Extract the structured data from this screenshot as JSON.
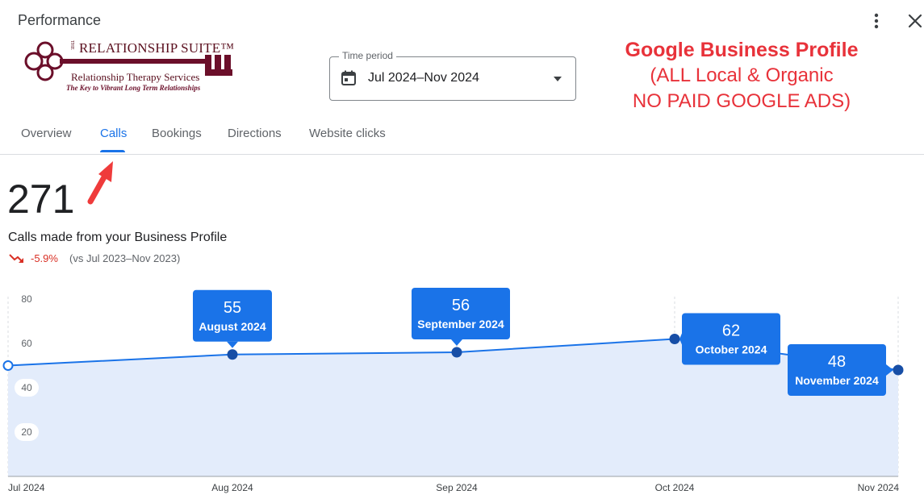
{
  "header": {
    "title": "Performance",
    "more_icon": "more-vert-icon",
    "close_icon": "close-icon"
  },
  "logo": {
    "lettering_name": "THE RELATIONSHIP SUITE™",
    "lettering_sub": "Relationship Therapy Services",
    "lettering_tag": "The Key to Vibrant Long Term Relationships",
    "colors": {
      "primary": "#5a0f1e"
    }
  },
  "time_period": {
    "label": "Time period",
    "value": "Jul 2024–Nov 2024",
    "icon": "calendar-icon"
  },
  "annotation": {
    "line1": "Google Business Profile",
    "line2": "(ALL Local & Organic",
    "line3": "NO PAID GOOGLE ADS)",
    "color": "#e8323a"
  },
  "tabs": [
    {
      "label": "Overview"
    },
    {
      "label": "Calls",
      "active": true
    },
    {
      "label": "Bookings"
    },
    {
      "label": "Directions"
    },
    {
      "label": "Website clicks"
    }
  ],
  "summary": {
    "total": "271",
    "description": "Calls made from your Business Profile",
    "change": "-5.9%",
    "comparison": "(vs Jul 2023–Nov 2023)",
    "trend_icon": "trending-down-icon",
    "change_color": "#d93025"
  },
  "chart_data": {
    "type": "area",
    "y_ticks": [
      80,
      60,
      40,
      20
    ],
    "ylim": [
      0,
      80
    ],
    "x_ticks": [
      "Jul 2024",
      "Aug 2024",
      "Sep 2024",
      "Oct 2024",
      "Nov 2024"
    ],
    "points": [
      {
        "month": "Jul 2024",
        "value": 50,
        "label": null
      },
      {
        "month": "Aug 2024",
        "value": 55,
        "label": "August 2024"
      },
      {
        "month": "Sep 2024",
        "value": 56,
        "label": "September 2024"
      },
      {
        "month": "Oct 2024",
        "value": 62,
        "label": "October 2024"
      },
      {
        "month": "Nov 2024",
        "value": 48,
        "label": "November 2024"
      }
    ],
    "grid": true,
    "colors": {
      "line": "#1a73e8",
      "fill": "#e3ecfb",
      "marker": "#174ea6",
      "tooltip": "#1a73e8"
    }
  }
}
